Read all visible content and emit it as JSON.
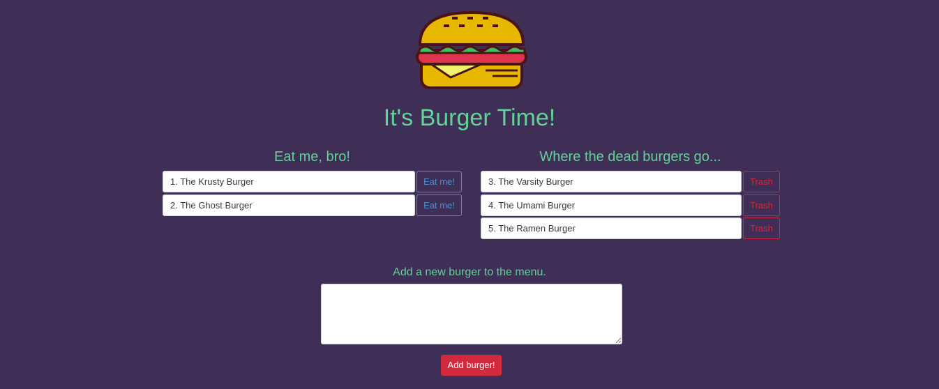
{
  "header": {
    "title": "It's Burger Time!",
    "logo_icon": "burger-icon"
  },
  "uneaten": {
    "heading": "Eat me, bro!",
    "button_label": "Eat me!",
    "items": [
      {
        "label": "1. The Krusty Burger"
      },
      {
        "label": "2. The Ghost Burger"
      }
    ]
  },
  "devoured": {
    "heading": "Where the dead burgers go...",
    "button_label": "Trash",
    "items": [
      {
        "label": "3. The Varsity Burger"
      },
      {
        "label": "4. The Umami Burger"
      },
      {
        "label": "5. The Ramen Burger"
      }
    ]
  },
  "form": {
    "heading": "Add a new burger to the menu.",
    "textarea_value": "",
    "submit_label": "Add burger!"
  },
  "colors": {
    "background": "#3f2e56",
    "heading_green": "#62d19a",
    "eat_blue": "#4f8fcf",
    "trash_red": "#d22a3d"
  }
}
